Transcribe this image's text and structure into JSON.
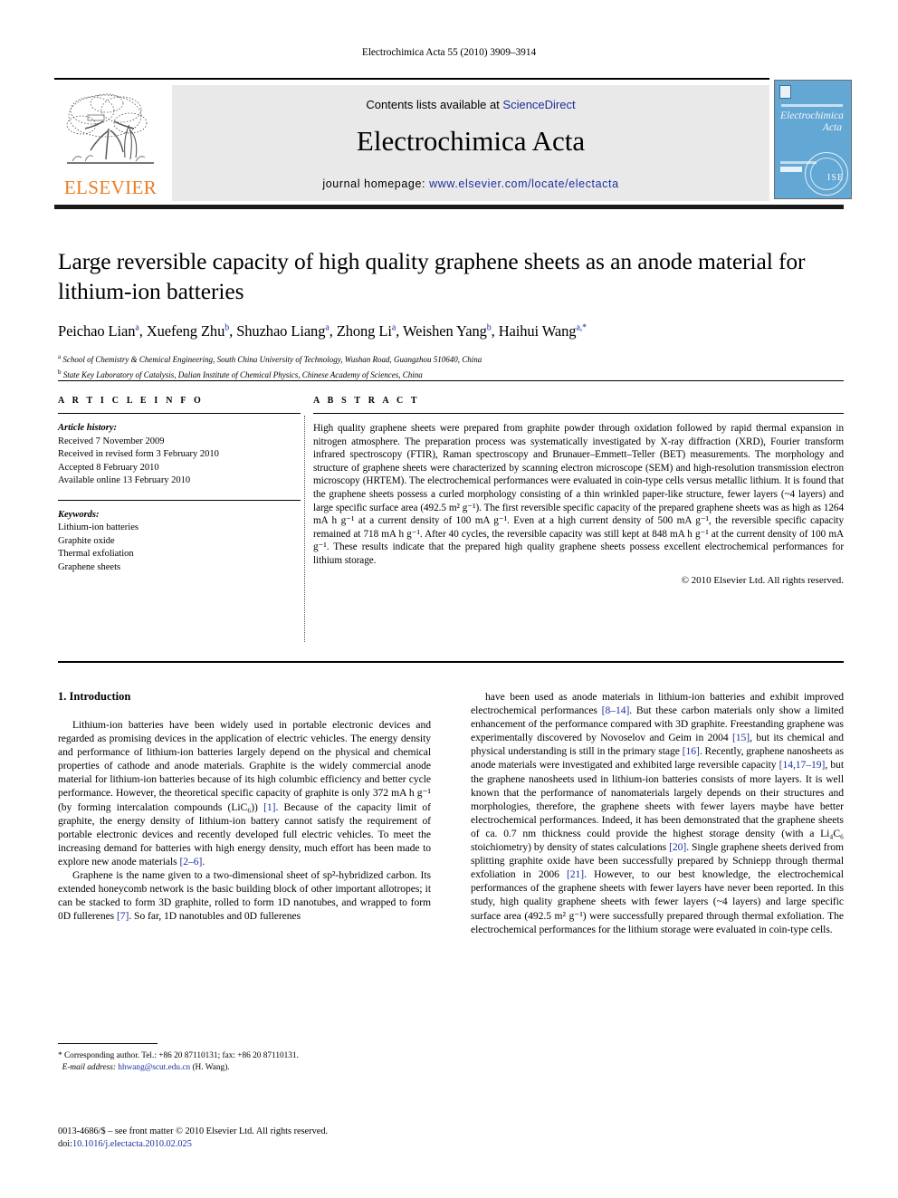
{
  "running_head": "Electrochimica Acta 55 (2010) 3909–3914",
  "masthead": {
    "contents_prefix": "Contents lists available at ",
    "sciencedirect": "ScienceDirect",
    "journal_title": "Electrochimica Acta",
    "homepage_prefix": "journal homepage: ",
    "homepage_url": "www.elsevier.com/locate/electacta",
    "publisher_logo_text": "ELSEVIER",
    "cover_journal_name_line1": "Electrochimica",
    "cover_journal_name_line2": "Acta",
    "cover_seal_text": "ISE",
    "link_color": "#1a2f9e",
    "elsevier_orange": "#eb7c22",
    "cover_blue": "#63a7d4"
  },
  "article": {
    "title": "Large reversible capacity of high quality graphene sheets as an anode material for lithium-ion batteries",
    "authors": [
      {
        "name": "Peichao Lian",
        "sup": "a",
        "sep": ", "
      },
      {
        "name": "Xuefeng Zhu",
        "sup": "b",
        "sep": ", "
      },
      {
        "name": "Shuzhao Liang",
        "sup": "a",
        "sep": ", "
      },
      {
        "name": "Zhong Li",
        "sup": "a",
        "sep": ", "
      },
      {
        "name": "Weishen Yang",
        "sup": "b",
        "sep": ", "
      },
      {
        "name": "Haihui Wang",
        "sup": "a,*",
        "sep": ""
      }
    ],
    "affiliations": [
      {
        "sup": "a",
        "text": "School of Chemistry & Chemical Engineering, South China University of Technology, Wushan Road, Guangzhou 510640, China"
      },
      {
        "sup": "b",
        "text": "State Key Laboratory of Catalysis, Dalian Institute of Chemical Physics, Chinese Academy of Sciences, China"
      }
    ]
  },
  "article_info": {
    "heading": "A R T I C L E   I N F O",
    "history_label": "Article history:",
    "history": [
      "Received 7 November 2009",
      "Received in revised form 3 February 2010",
      "Accepted 8 February 2010",
      "Available online 13 February 2010"
    ],
    "keywords_label": "Keywords:",
    "keywords": [
      "Lithium-ion batteries",
      "Graphite oxide",
      "Thermal exfoliation",
      "Graphene sheets"
    ]
  },
  "abstract": {
    "heading": "A B S T R A C T",
    "text": "High quality graphene sheets were prepared from graphite powder through oxidation followed by rapid thermal expansion in nitrogen atmosphere. The preparation process was systematically investigated by X-ray diffraction (XRD), Fourier transform infrared spectroscopy (FTIR), Raman spectroscopy and Brunauer–Emmett–Teller (BET) measurements. The morphology and structure of graphene sheets were characterized by scanning electron microscope (SEM) and high-resolution transmission electron microscopy (HRTEM). The electrochemical performances were evaluated in coin-type cells versus metallic lithium. It is found that the graphene sheets possess a curled morphology consisting of a thin wrinkled paper-like structure, fewer layers (~4 layers) and large specific surface area (492.5 m² g⁻¹). The first reversible specific capacity of the prepared graphene sheets was as high as 1264 mA h g⁻¹ at a current density of 100 mA g⁻¹. Even at a high current density of 500 mA g⁻¹, the reversible specific capacity remained at 718 mA h g⁻¹. After 40 cycles, the reversible capacity was still kept at 848 mA h g⁻¹ at the current density of 100 mA g⁻¹. These results indicate that the prepared high quality graphene sheets possess excellent electrochemical performances for lithium storage.",
    "copyright": "© 2010 Elsevier Ltd. All rights reserved."
  },
  "introduction": {
    "section_number_title": "1. Introduction",
    "left_paragraphs": [
      "Lithium-ion batteries have been widely used in portable electronic devices and regarded as promising devices in the application of electric vehicles. The energy density and performance of lithium-ion batteries largely depend on the physical and chemical properties of cathode and anode materials. Graphite is the widely commercial anode material for lithium-ion batteries because of its high columbic efficiency and better cycle performance. However, the theoretical specific capacity of graphite is only 372 mA h g⁻¹ (by forming intercalation compounds (LiC₆)) [1]. Because of the capacity limit of graphite, the energy density of lithium-ion battery cannot satisfy the requirement of portable electronic devices and recently developed full electric vehicles. To meet the increasing demand for batteries with high energy density, much effort has been made to explore new anode materials [2–6].",
      "Graphene is the name given to a two-dimensional sheet of sp²-hybridized carbon. Its extended honeycomb network is the basic building block of other important allotropes; it can be stacked to form 3D graphite, rolled to form 1D nanotubes, and wrapped to form 0D fullerenes [7]. So far, 1D nanotubles and 0D fullerenes"
    ],
    "right_paragraphs": [
      "have been used as anode materials in lithium-ion batteries and exhibit improved electrochemical performances [8–14]. But these carbon materials only show a limited enhancement of the performance compared with 3D graphite. Freestanding graphene was experimentally discovered by Novoselov and Geim in 2004 [15], but its chemical and physical understanding is still in the primary stage [16]. Recently, graphene nanosheets as anode materials were investigated and exhibited large reversible capacity [14,17–19], but the graphene nanosheets used in lithium-ion batteries consists of more layers. It is well known that the performance of nanomaterials largely depends on their structures and morphologies, therefore, the graphene sheets with fewer layers maybe have better electrochemical performances. Indeed, it has been demonstrated that the graphene sheets of ca. 0.7 nm thickness could provide the highest storage density (with a Li₄C₆ stoichiometry) by density of states calculations [20]. Single graphene sheets derived from splitting graphite oxide have been successfully prepared by Schniepp through thermal exfoliation in 2006 [21]. However, to our best knowledge, the electrochemical performances of the graphene sheets with fewer layers have never been reported. In this study, high quality graphene sheets with fewer layers (~4 layers) and large specific surface area (492.5 m² g⁻¹) were successfully prepared through thermal exfoliation. The electrochemical performances for the lithium storage were evaluated in coin-type cells."
    ]
  },
  "footnote": {
    "corresponding": "* Corresponding author. Tel.: +86 20 87110131; fax: +86 20 87110131.",
    "email_label": "E-mail address:",
    "email": "hhwang@scut.edu.cn",
    "email_suffix": " (H. Wang)."
  },
  "footer": {
    "issn_line": "0013-4686/$ – see front matter © 2010 Elsevier Ltd. All rights reserved.",
    "doi_label": "doi:",
    "doi_value": "10.1016/j.electacta.2010.02.025"
  }
}
